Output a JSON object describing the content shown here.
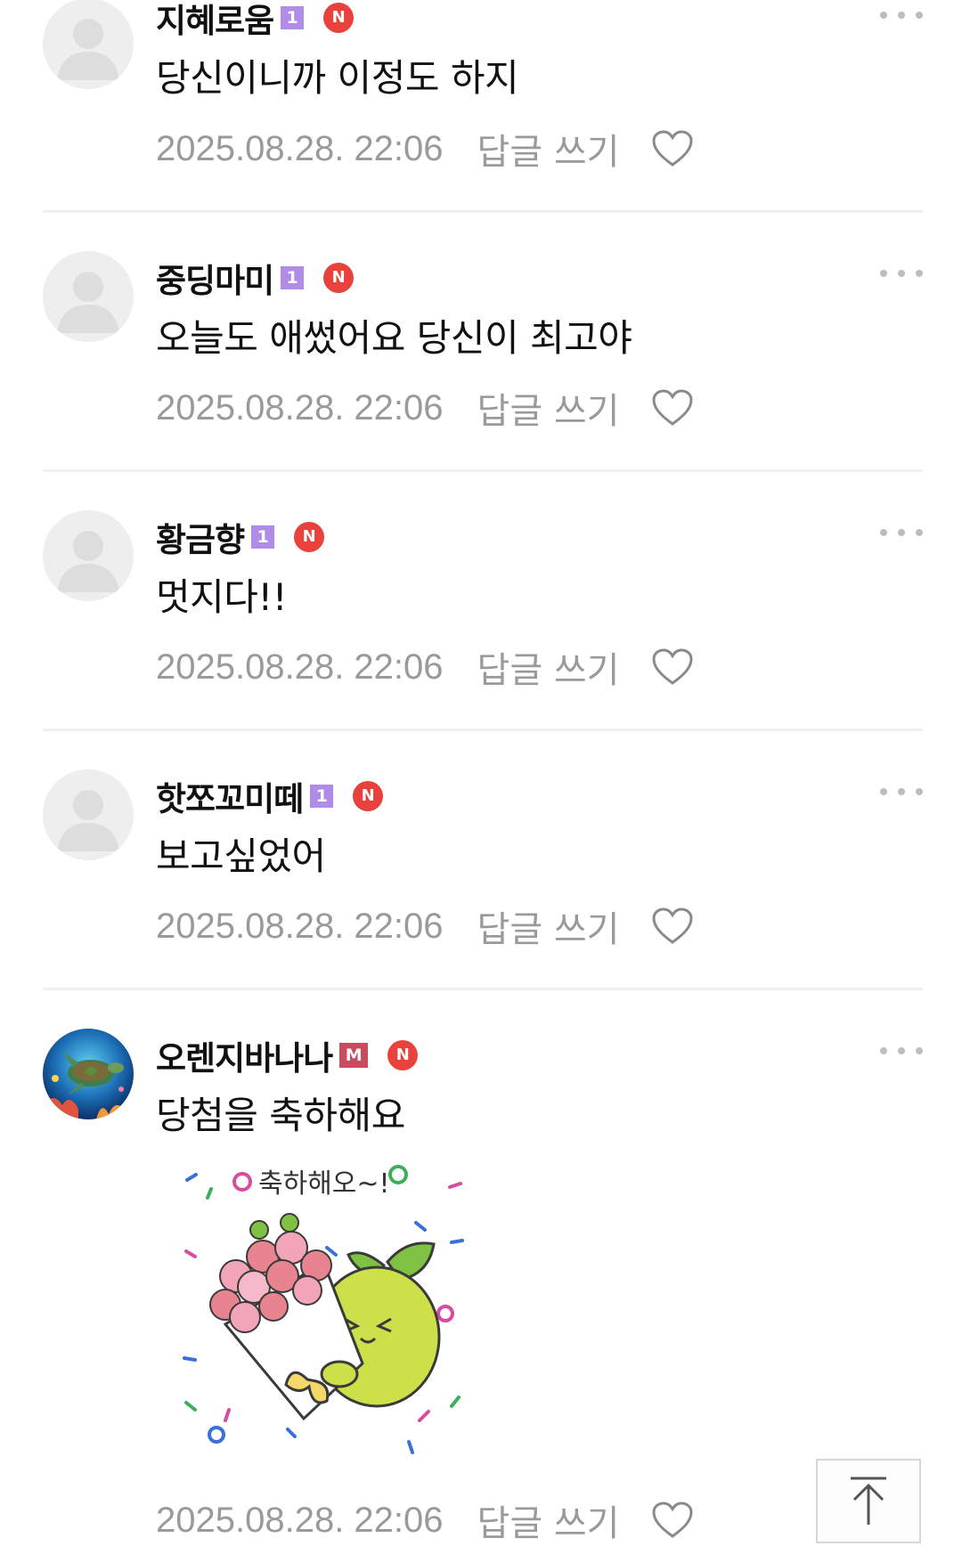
{
  "icons": {
    "more": "more-dots-icon",
    "like": "heart-outline-icon",
    "scroll_top": "arrow-up-to-top-icon",
    "default_avatar": "default-profile-icon"
  },
  "colors": {
    "level_badge": "#b08ce6",
    "manager_badge": "#c94b5e",
    "new_badge": "#e9413b",
    "meta_text": "#9a9a9a"
  },
  "comments": [
    {
      "nickname": "지혜로움",
      "level": "1",
      "new_badge": "N",
      "text": "당신이니까 이정도 하지",
      "timestamp": "2025.08.28. 22:06",
      "reply_label": "답글 쓰기"
    },
    {
      "nickname": "중딩마미",
      "level": "1",
      "new_badge": "N",
      "text": "오늘도 애썼어요 당신이 최고야",
      "timestamp": "2025.08.28. 22:06",
      "reply_label": "답글 쓰기"
    },
    {
      "nickname": "황금향",
      "level": "1",
      "new_badge": "N",
      "text": "멋지다!!",
      "timestamp": "2025.08.28. 22:06",
      "reply_label": "답글 쓰기"
    },
    {
      "nickname": "핫쪼꼬미떼",
      "level": "1",
      "new_badge": "N",
      "text": "보고싶었어",
      "timestamp": "2025.08.28. 22:06",
      "reply_label": "답글 쓰기"
    },
    {
      "nickname": "오렌지바나나",
      "level": "M",
      "new_badge": "N",
      "text": "당첨을 축하해요",
      "sticker_text": "축하해오~!",
      "timestamp": "2025.08.28. 22:06",
      "reply_label": "답글 쓰기"
    }
  ]
}
